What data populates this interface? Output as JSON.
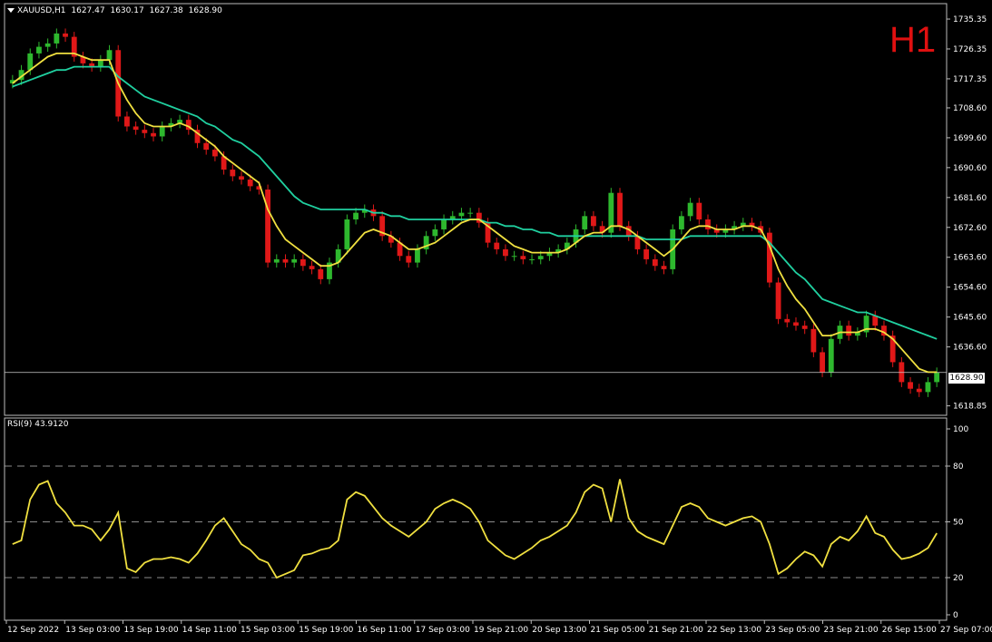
{
  "header": {
    "symbol": "XAUUSD,H1",
    "open": "1627.47",
    "high": "1630.17",
    "low": "1627.38",
    "close": "1628.90"
  },
  "timeframe_label": "H1",
  "rsi_header": "RSI(9) 43.9120",
  "current_price_label": "1628.90",
  "colors": {
    "background": "#000000",
    "bull": "#2eb82e",
    "bear": "#e01818",
    "ma_fast": "#f0e040",
    "ma_slow": "#20d0a0",
    "rsi": "#f0e040",
    "timeframe": "#e01010"
  },
  "chart_data": [
    {
      "type": "candlestick",
      "title": "XAUUSD,H1",
      "ylim": [
        1616,
        1740
      ],
      "y_ticks": [
        "1735.35",
        "1726.35",
        "1717.35",
        "1708.60",
        "1699.60",
        "1690.60",
        "1681.60",
        "1672.60",
        "1663.60",
        "1654.60",
        "1645.60",
        "1636.60",
        "1618.85"
      ],
      "x_ticks": [
        "12 Sep 2022",
        "13 Sep 03:00",
        "13 Sep 19:00",
        "14 Sep 11:00",
        "15 Sep 03:00",
        "15 Sep 19:00",
        "16 Sep 11:00",
        "17 Sep 03:00",
        "19 Sep 21:00",
        "20 Sep 13:00",
        "21 Sep 05:00",
        "21 Sep 21:00",
        "22 Sep 13:00",
        "23 Sep 05:00",
        "23 Sep 21:00",
        "26 Sep 15:00",
        "27 Sep 07:00"
      ],
      "close_series": [
        1717,
        1720,
        1725,
        1727,
        1728,
        1731,
        1730,
        1724,
        1722,
        1721,
        1723,
        1726,
        1706,
        1703,
        1702,
        1701,
        1700,
        1703,
        1704,
        1705,
        1702,
        1698,
        1696,
        1694,
        1690,
        1688,
        1687,
        1685,
        1684,
        1662,
        1663,
        1662,
        1663,
        1661,
        1660,
        1657,
        1662,
        1666,
        1675,
        1677,
        1678,
        1676,
        1670,
        1668,
        1664,
        1662,
        1666,
        1670,
        1672,
        1675,
        1676,
        1677,
        1677,
        1674,
        1668,
        1666,
        1664,
        1664,
        1663,
        1663,
        1664,
        1665,
        1666,
        1668,
        1672,
        1676,
        1673,
        1671,
        1683,
        1673,
        1670,
        1666,
        1663,
        1661,
        1660,
        1672,
        1676,
        1680,
        1675,
        1672,
        1671,
        1672,
        1673,
        1674,
        1673,
        1671,
        1656,
        1645,
        1644,
        1643,
        1642,
        1635,
        1629,
        1639,
        1643,
        1640,
        1641,
        1646,
        1643,
        1640,
        1632,
        1626,
        1624,
        1623,
        1626,
        1628.9
      ],
      "ma_fast": {
        "name": "",
        "values": [
          1716,
          1718,
          1720,
          1722,
          1724,
          1725,
          1725,
          1725,
          1724,
          1723,
          1723,
          1723,
          1716,
          1711,
          1707,
          1704,
          1703,
          1703,
          1703,
          1704,
          1703,
          1701,
          1699,
          1697,
          1694,
          1692,
          1690,
          1688,
          1686,
          1678,
          1673,
          1669,
          1667,
          1665,
          1663,
          1661,
          1661,
          1662,
          1665,
          1668,
          1671,
          1672,
          1671,
          1670,
          1668,
          1666,
          1666,
          1667,
          1668,
          1670,
          1672,
          1674,
          1675,
          1675,
          1673,
          1671,
          1669,
          1667,
          1666,
          1665,
          1665,
          1665,
          1665,
          1666,
          1668,
          1670,
          1671,
          1671,
          1673,
          1673,
          1672,
          1670,
          1668,
          1666,
          1664,
          1666,
          1669,
          1672,
          1673,
          1673,
          1672,
          1672,
          1672,
          1673,
          1673,
          1672,
          1667,
          1660,
          1655,
          1651,
          1648,
          1644,
          1640,
          1640,
          1641,
          1641,
          1641,
          1642,
          1642,
          1641,
          1639,
          1636,
          1633,
          1630,
          1629,
          1629
        ]
      },
      "ma_slow": {
        "name": "",
        "values": [
          1715,
          1716,
          1717,
          1718,
          1719,
          1720,
          1720,
          1721,
          1721,
          1721,
          1721,
          1721,
          1718,
          1716,
          1714,
          1712,
          1711,
          1710,
          1709,
          1708,
          1707,
          1706,
          1704,
          1703,
          1701,
          1699,
          1698,
          1696,
          1694,
          1691,
          1688,
          1685,
          1682,
          1680,
          1679,
          1678,
          1678,
          1678,
          1678,
          1678,
          1678,
          1677,
          1677,
          1676,
          1676,
          1675,
          1675,
          1675,
          1675,
          1675,
          1675,
          1675,
          1675,
          1675,
          1674,
          1674,
          1673,
          1673,
          1672,
          1672,
          1671,
          1671,
          1670,
          1670,
          1670,
          1670,
          1670,
          1670,
          1670,
          1670,
          1670,
          1670,
          1669,
          1669,
          1669,
          1669,
          1669,
          1670,
          1670,
          1670,
          1670,
          1670,
          1670,
          1670,
          1670,
          1670,
          1668,
          1665,
          1662,
          1659,
          1657,
          1654,
          1651,
          1650,
          1649,
          1648,
          1647,
          1647,
          1646,
          1645,
          1644,
          1643,
          1642,
          1641,
          1640,
          1639
        ]
      }
    },
    {
      "type": "line",
      "title": "RSI(9) 43.9120",
      "ylim": [
        0,
        100
      ],
      "y_ticks": [
        "100",
        "80",
        "50",
        "20",
        "0"
      ],
      "levels": [
        80,
        50,
        20
      ],
      "series": [
        {
          "name": "",
          "values": [
            38,
            40,
            62,
            70,
            72,
            60,
            55,
            48,
            48,
            46,
            40,
            46,
            55,
            25,
            23,
            28,
            30,
            30,
            31,
            30,
            28,
            33,
            40,
            48,
            52,
            45,
            38,
            35,
            30,
            28,
            20,
            22,
            24,
            32,
            33,
            35,
            36,
            40,
            62,
            66,
            64,
            58,
            52,
            48,
            45,
            42,
            46,
            50,
            57,
            60,
            62,
            60,
            57,
            50,
            40,
            36,
            32,
            30,
            33,
            36,
            40,
            42,
            45,
            48,
            55,
            66,
            70,
            68,
            50,
            73,
            52,
            45,
            42,
            40,
            38,
            48,
            58,
            60,
            58,
            52,
            50,
            48,
            50,
            52,
            53,
            50,
            38,
            22,
            25,
            30,
            34,
            32,
            26,
            38,
            42,
            40,
            45,
            53,
            44,
            42,
            35,
            30,
            31,
            33,
            36,
            43.9
          ]
        }
      ]
    }
  ]
}
